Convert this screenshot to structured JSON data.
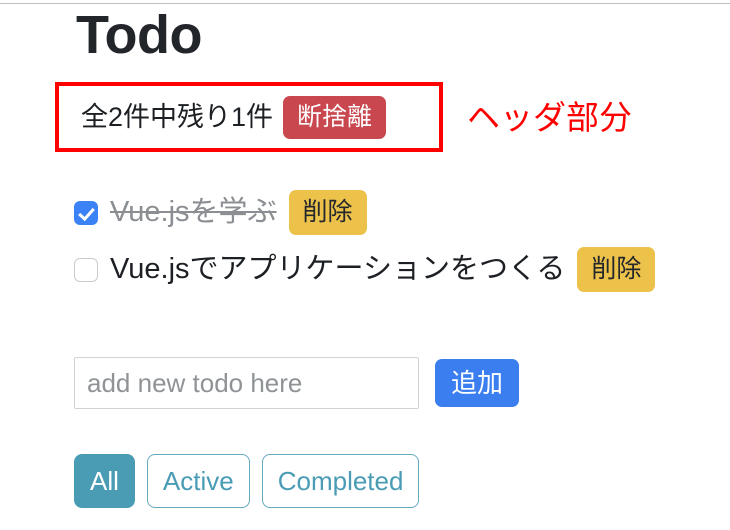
{
  "app": {
    "title": "Todo"
  },
  "header": {
    "count_text": "全2件中残り1件",
    "purge_label": "断捨離"
  },
  "annotation": {
    "header_label": "ヘッダ部分",
    "color": "#ff0000"
  },
  "todos": [
    {
      "label": "Vue.jsを学ぶ",
      "done": true,
      "delete_label": "削除"
    },
    {
      "label": "Vue.jsでアプリケーションをつくる",
      "done": false,
      "delete_label": "削除"
    }
  ],
  "add_form": {
    "value": "",
    "placeholder": "add new todo here",
    "add_label": "追加"
  },
  "filters": {
    "selected": "All",
    "items": [
      {
        "label": "All"
      },
      {
        "label": "Active"
      },
      {
        "label": "Completed"
      }
    ]
  },
  "colors": {
    "purge_red": "#c9484f",
    "delete_yellow": "#edc24b",
    "add_blue": "#3b7ef0",
    "filter_teal": "#4a9cb5",
    "checkbox_blue": "#3b82f6",
    "annotation_red": "#ff0000",
    "done_text_gray": "#8b8f93"
  }
}
